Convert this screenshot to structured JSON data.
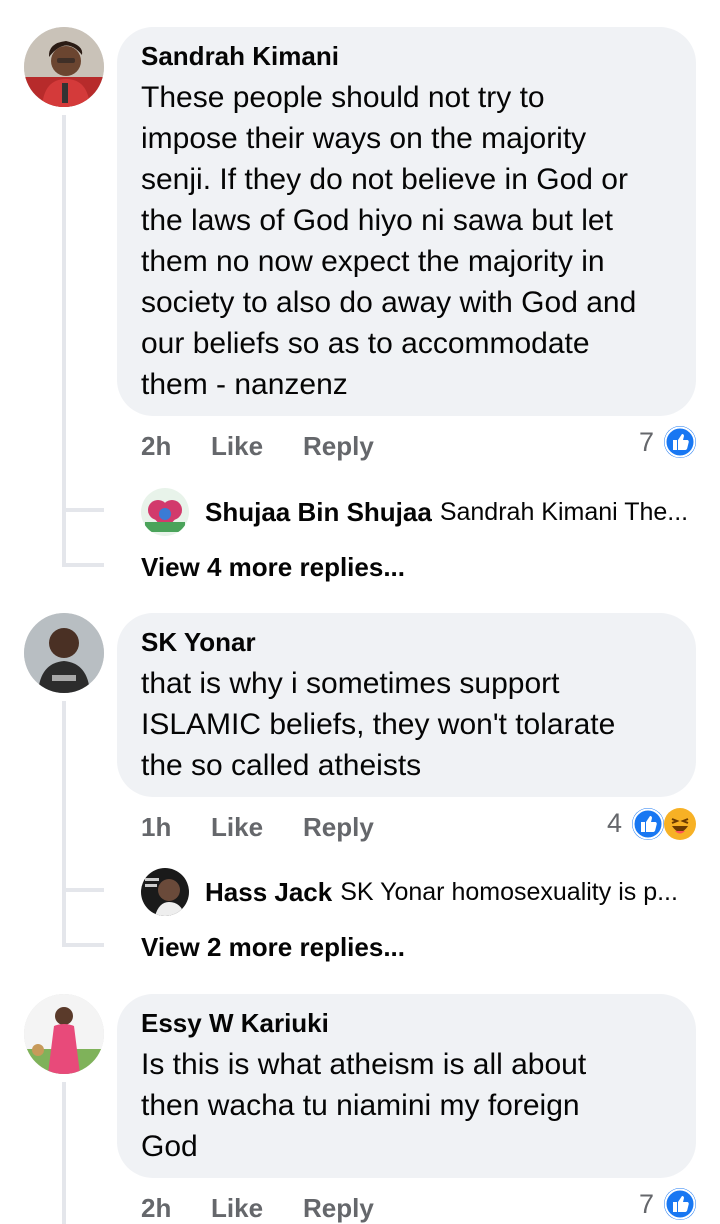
{
  "comments": [
    {
      "author": "Sandrah Kimani",
      "text": "These people should not try to impose their ways on the majority senji. If they do not believe in God or the laws of God hiyo ni sawa but let them no now expect the majority in society to also do away with God and our beliefs so as to accommodate them - nanzenz",
      "text_lines": [
        "These people should not try to",
        "impose their ways on the majority",
        "senji. If they do not believe in God or",
        "the laws of God hiyo ni sawa but let",
        "them no now expect the majority in",
        "society to also do away with God and",
        "our beliefs so as to accommodate",
        "them - nanzenz"
      ],
      "time": "2h",
      "like_label": "Like",
      "reply_label": "Reply",
      "reaction_count": "7",
      "reactions": [
        "like-icon"
      ],
      "reply_preview": {
        "author": "Shujaa Bin Shujaa",
        "text": "Sandrah Kimani The..."
      },
      "view_more": "View 4 more replies..."
    },
    {
      "author": "SK Yonar",
      "text_lines": [
        "that is why i sometimes support",
        "ISLAMIC beliefs,  they won't tolarate",
        "the so called atheists"
      ],
      "time": "1h",
      "like_label": "Like",
      "reply_label": "Reply",
      "reaction_count": "4",
      "reactions": [
        "like-icon",
        "haha-icon"
      ],
      "reply_preview": {
        "author": "Hass Jack",
        "text": "SK Yonar homosexuality is p..."
      },
      "view_more": "View 2 more replies..."
    },
    {
      "author": "Essy W Kariuki",
      "text_lines": [
        "Is this is what atheism is all about",
        "then wacha tu niamini my foreign",
        "God"
      ],
      "time": "2h",
      "like_label": "Like",
      "reply_label": "Reply",
      "reaction_count": "7",
      "reactions": [
        "like-icon"
      ]
    }
  ],
  "colors": {
    "bubble": "#f0f2f5",
    "meta_text": "#65676b",
    "like_blue": "#1877f2",
    "haha_yellow": "#f7b125",
    "thread_line": "#e4e6eb"
  }
}
